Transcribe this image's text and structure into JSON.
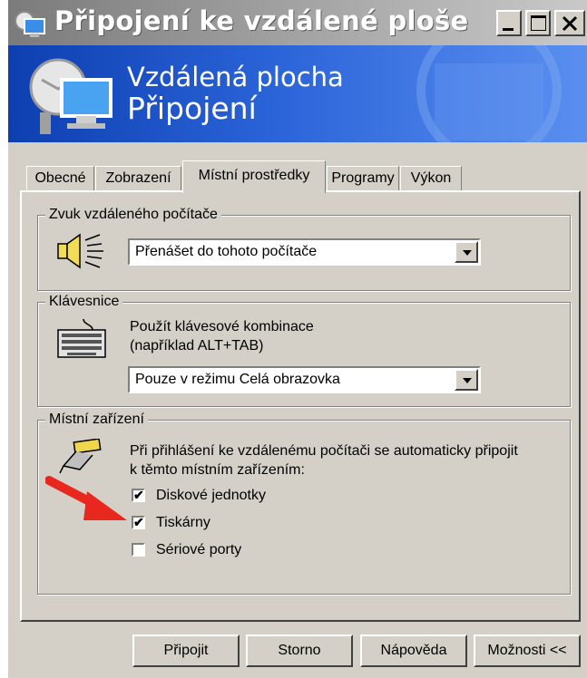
{
  "window": {
    "title": "Připojení ke vzdálené ploše",
    "banner_line1": "Vzdálená plocha",
    "banner_line2": "Připojení"
  },
  "tabs": [
    {
      "label": "Obecné"
    },
    {
      "label": "Zobrazení"
    },
    {
      "label": "Místní prostředky",
      "active": true
    },
    {
      "label": "Programy"
    },
    {
      "label": "Výkon"
    }
  ],
  "sound_group": {
    "legend": "Zvuk vzdáleného počítače",
    "selected": "Přenášet do tohoto počítače"
  },
  "keyboard_group": {
    "legend": "Klávesnice",
    "description_line1": "Použít klávesové kombinace",
    "description_line2": "(například ALT+TAB)",
    "selected": "Pouze v režimu Celá obrazovka"
  },
  "devices_group": {
    "legend": "Místní zařízení",
    "description_line1": "Při přihlášení ke vzdálenému počítači se automaticky připojit",
    "description_line2": "k těmto místním zařízením:",
    "items": [
      {
        "label": "Diskové jednotky",
        "checked": true
      },
      {
        "label": "Tiskárny",
        "checked": true
      },
      {
        "label": "Sériové porty",
        "checked": false
      }
    ]
  },
  "buttons": {
    "connect": "Připojit",
    "cancel": "Storno",
    "help": "Nápověda",
    "options": "Možnosti <<"
  },
  "colors": {
    "dialog_face": "#d4d0c8",
    "banner_blue": "#2a63d8",
    "annotation_arrow": "#e8281e"
  }
}
